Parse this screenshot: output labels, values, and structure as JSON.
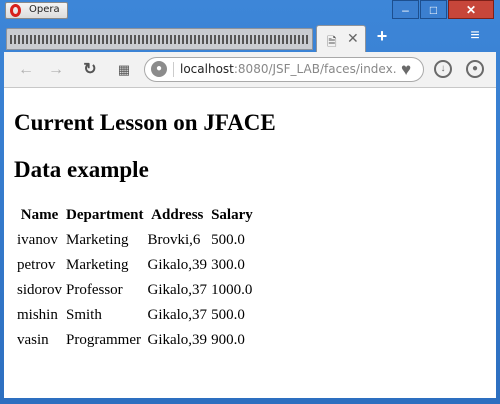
{
  "browser": {
    "brand_button_label": "Opera",
    "window_controls": {
      "minimize": "–",
      "maximize": "□",
      "close": "✕"
    },
    "tabs": [
      {
        "state": "loading"
      },
      {
        "state": "active",
        "close_glyph": "✕"
      }
    ],
    "new_tab_glyph": "+",
    "menu_glyph": "≡",
    "address": {
      "host": "localhost",
      "rest": ":8080/JSF_LAB/faces/index."
    }
  },
  "page": {
    "heading": "Current Lesson on JFACE",
    "subheading": "Data example",
    "table": {
      "headers": [
        "Name",
        "Department",
        "Address",
        "Salary"
      ],
      "rows": [
        [
          "ivanov",
          "Marketing",
          "Brovki,6",
          "500.0"
        ],
        [
          "petrov",
          "Marketing",
          "Gikalo,39",
          "300.0"
        ],
        [
          "sidorov",
          "Professor",
          "Gikalo,37",
          "1000.0"
        ],
        [
          "mishin",
          "Smith",
          "Gikalo,37",
          "500.0"
        ],
        [
          "vasin",
          "Programmer",
          "Gikalo,39",
          "900.0"
        ]
      ]
    }
  },
  "colors": {
    "title_bar": "#2d6fc0",
    "close_button": "#c7463a",
    "opera_logo": "#d8201b"
  },
  "icons": [
    "opera-logo-icon",
    "minimize-icon",
    "maximize-icon",
    "close-icon",
    "document-icon",
    "tab-close-icon",
    "new-tab-icon",
    "menu-icon",
    "back-icon",
    "forward-icon",
    "reload-icon",
    "speed-dial-icon",
    "globe-icon",
    "heart-icon",
    "download-icon",
    "profile-icon"
  ]
}
